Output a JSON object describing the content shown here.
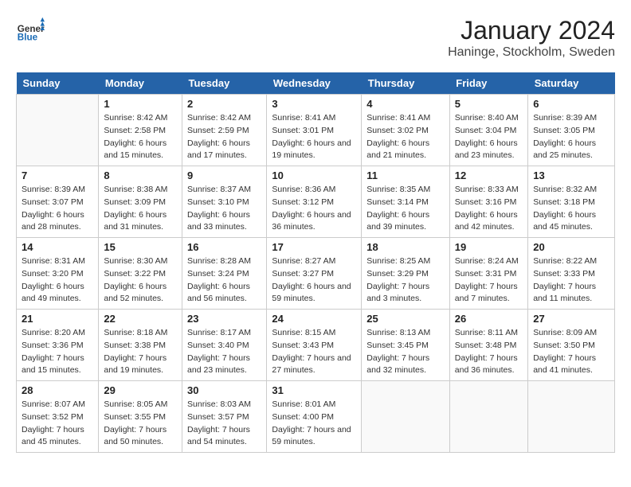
{
  "header": {
    "logo_general": "General",
    "logo_blue": "Blue",
    "month_year": "January 2024",
    "location": "Haninge, Stockholm, Sweden"
  },
  "weekdays": [
    "Sunday",
    "Monday",
    "Tuesday",
    "Wednesday",
    "Thursday",
    "Friday",
    "Saturday"
  ],
  "weeks": [
    [
      {
        "day": "",
        "sunrise": "",
        "sunset": "",
        "daylight": ""
      },
      {
        "day": "1",
        "sunrise": "Sunrise: 8:42 AM",
        "sunset": "Sunset: 2:58 PM",
        "daylight": "Daylight: 6 hours and 15 minutes."
      },
      {
        "day": "2",
        "sunrise": "Sunrise: 8:42 AM",
        "sunset": "Sunset: 2:59 PM",
        "daylight": "Daylight: 6 hours and 17 minutes."
      },
      {
        "day": "3",
        "sunrise": "Sunrise: 8:41 AM",
        "sunset": "Sunset: 3:01 PM",
        "daylight": "Daylight: 6 hours and 19 minutes."
      },
      {
        "day": "4",
        "sunrise": "Sunrise: 8:41 AM",
        "sunset": "Sunset: 3:02 PM",
        "daylight": "Daylight: 6 hours and 21 minutes."
      },
      {
        "day": "5",
        "sunrise": "Sunrise: 8:40 AM",
        "sunset": "Sunset: 3:04 PM",
        "daylight": "Daylight: 6 hours and 23 minutes."
      },
      {
        "day": "6",
        "sunrise": "Sunrise: 8:39 AM",
        "sunset": "Sunset: 3:05 PM",
        "daylight": "Daylight: 6 hours and 25 minutes."
      }
    ],
    [
      {
        "day": "7",
        "sunrise": "Sunrise: 8:39 AM",
        "sunset": "Sunset: 3:07 PM",
        "daylight": "Daylight: 6 hours and 28 minutes."
      },
      {
        "day": "8",
        "sunrise": "Sunrise: 8:38 AM",
        "sunset": "Sunset: 3:09 PM",
        "daylight": "Daylight: 6 hours and 31 minutes."
      },
      {
        "day": "9",
        "sunrise": "Sunrise: 8:37 AM",
        "sunset": "Sunset: 3:10 PM",
        "daylight": "Daylight: 6 hours and 33 minutes."
      },
      {
        "day": "10",
        "sunrise": "Sunrise: 8:36 AM",
        "sunset": "Sunset: 3:12 PM",
        "daylight": "Daylight: 6 hours and 36 minutes."
      },
      {
        "day": "11",
        "sunrise": "Sunrise: 8:35 AM",
        "sunset": "Sunset: 3:14 PM",
        "daylight": "Daylight: 6 hours and 39 minutes."
      },
      {
        "day": "12",
        "sunrise": "Sunrise: 8:33 AM",
        "sunset": "Sunset: 3:16 PM",
        "daylight": "Daylight: 6 hours and 42 minutes."
      },
      {
        "day": "13",
        "sunrise": "Sunrise: 8:32 AM",
        "sunset": "Sunset: 3:18 PM",
        "daylight": "Daylight: 6 hours and 45 minutes."
      }
    ],
    [
      {
        "day": "14",
        "sunrise": "Sunrise: 8:31 AM",
        "sunset": "Sunset: 3:20 PM",
        "daylight": "Daylight: 6 hours and 49 minutes."
      },
      {
        "day": "15",
        "sunrise": "Sunrise: 8:30 AM",
        "sunset": "Sunset: 3:22 PM",
        "daylight": "Daylight: 6 hours and 52 minutes."
      },
      {
        "day": "16",
        "sunrise": "Sunrise: 8:28 AM",
        "sunset": "Sunset: 3:24 PM",
        "daylight": "Daylight: 6 hours and 56 minutes."
      },
      {
        "day": "17",
        "sunrise": "Sunrise: 8:27 AM",
        "sunset": "Sunset: 3:27 PM",
        "daylight": "Daylight: 6 hours and 59 minutes."
      },
      {
        "day": "18",
        "sunrise": "Sunrise: 8:25 AM",
        "sunset": "Sunset: 3:29 PM",
        "daylight": "Daylight: 7 hours and 3 minutes."
      },
      {
        "day": "19",
        "sunrise": "Sunrise: 8:24 AM",
        "sunset": "Sunset: 3:31 PM",
        "daylight": "Daylight: 7 hours and 7 minutes."
      },
      {
        "day": "20",
        "sunrise": "Sunrise: 8:22 AM",
        "sunset": "Sunset: 3:33 PM",
        "daylight": "Daylight: 7 hours and 11 minutes."
      }
    ],
    [
      {
        "day": "21",
        "sunrise": "Sunrise: 8:20 AM",
        "sunset": "Sunset: 3:36 PM",
        "daylight": "Daylight: 7 hours and 15 minutes."
      },
      {
        "day": "22",
        "sunrise": "Sunrise: 8:18 AM",
        "sunset": "Sunset: 3:38 PM",
        "daylight": "Daylight: 7 hours and 19 minutes."
      },
      {
        "day": "23",
        "sunrise": "Sunrise: 8:17 AM",
        "sunset": "Sunset: 3:40 PM",
        "daylight": "Daylight: 7 hours and 23 minutes."
      },
      {
        "day": "24",
        "sunrise": "Sunrise: 8:15 AM",
        "sunset": "Sunset: 3:43 PM",
        "daylight": "Daylight: 7 hours and 27 minutes."
      },
      {
        "day": "25",
        "sunrise": "Sunrise: 8:13 AM",
        "sunset": "Sunset: 3:45 PM",
        "daylight": "Daylight: 7 hours and 32 minutes."
      },
      {
        "day": "26",
        "sunrise": "Sunrise: 8:11 AM",
        "sunset": "Sunset: 3:48 PM",
        "daylight": "Daylight: 7 hours and 36 minutes."
      },
      {
        "day": "27",
        "sunrise": "Sunrise: 8:09 AM",
        "sunset": "Sunset: 3:50 PM",
        "daylight": "Daylight: 7 hours and 41 minutes."
      }
    ],
    [
      {
        "day": "28",
        "sunrise": "Sunrise: 8:07 AM",
        "sunset": "Sunset: 3:52 PM",
        "daylight": "Daylight: 7 hours and 45 minutes."
      },
      {
        "day": "29",
        "sunrise": "Sunrise: 8:05 AM",
        "sunset": "Sunset: 3:55 PM",
        "daylight": "Daylight: 7 hours and 50 minutes."
      },
      {
        "day": "30",
        "sunrise": "Sunrise: 8:03 AM",
        "sunset": "Sunset: 3:57 PM",
        "daylight": "Daylight: 7 hours and 54 minutes."
      },
      {
        "day": "31",
        "sunrise": "Sunrise: 8:01 AM",
        "sunset": "Sunset: 4:00 PM",
        "daylight": "Daylight: 7 hours and 59 minutes."
      },
      {
        "day": "",
        "sunrise": "",
        "sunset": "",
        "daylight": ""
      },
      {
        "day": "",
        "sunrise": "",
        "sunset": "",
        "daylight": ""
      },
      {
        "day": "",
        "sunrise": "",
        "sunset": "",
        "daylight": ""
      }
    ]
  ]
}
